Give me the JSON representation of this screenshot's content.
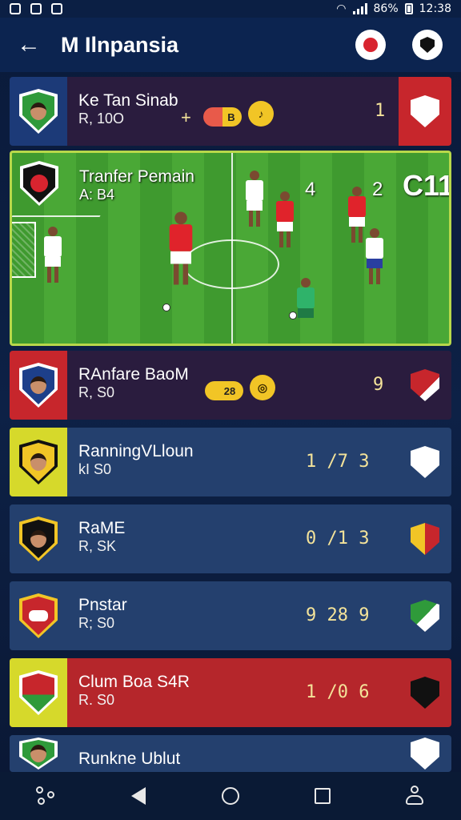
{
  "status_bar": {
    "battery": "86%",
    "time": "12:38"
  },
  "header": {
    "title": "M Ilnpansia"
  },
  "featured": {
    "name": "Tranfer Pemain",
    "sub": "A: B4",
    "num_a": "4",
    "num_b": "2",
    "tag": "C11"
  },
  "rows": [
    {
      "name": "Ke Tan Sinab",
      "sub": "R, 10O",
      "plus": "+",
      "pill": "B",
      "score": "1"
    },
    {
      "name": "RAnfare BaoM",
      "sub": "R, S0",
      "pill": "28",
      "score": "9"
    },
    {
      "name": "RanningVLloun",
      "sub": "kI S0",
      "score": "1 /7 3"
    },
    {
      "name": "RaME",
      "sub": "R, SK",
      "score": "0 /1 3"
    },
    {
      "name": "Pnstar",
      "sub": "R; S0",
      "score": "9 28 9"
    },
    {
      "name": "Clum Boa S4R",
      "sub": "R. S0",
      "score": "1 /0 6"
    },
    {
      "name": "Runkne Ublut",
      "sub": "",
      "score": ""
    }
  ],
  "colors": {
    "header_bg": "#0c2450",
    "row_dark": "#2a1c3e",
    "row_blue": "#24406e",
    "row_red": "#b5262b",
    "accent_yellow": "#d6d92b",
    "field_border": "#b8d84a"
  },
  "nav": {
    "icons": [
      "network-icon",
      "back-triangle-icon",
      "home-circle-icon",
      "recents-square-icon",
      "person-icon"
    ]
  }
}
